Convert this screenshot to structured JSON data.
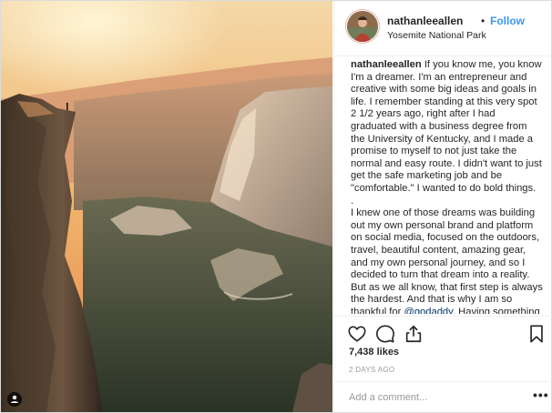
{
  "post": {
    "username": "nathanleeallen",
    "separator": "•",
    "follow_label": "Follow",
    "location": "Yosemite National Park",
    "caption": {
      "username": "nathanleeallen",
      "paragraph1": " If you know me, you know I'm a dreamer. I'm an entrepreneur and creative with some big ideas and goals in life. I remember standing at this very spot 2 1/2 years ago, right after I had graduated with a business degree from the University of Kentucky, and I made a promise to myself to not just take the normal and easy route. I didn't want to just get the safe marketing job and be \"comfortable.\" I wanted to do bold things.",
      "divider": ".",
      "paragraph2_before": "I knew one of those dreams was building out my own personal brand and platform on social media, focused on the outdoors, travel, beautiful content, amazing gear, and my own personal journey, and so I decided to turn that dream into a reality. But as we all know, that first step is always the hardest. And that is why I am so thankful for ",
      "mention": "@godaddy",
      "paragraph2_after": ". Having something simple"
    },
    "likes": "7,438 likes",
    "date": "2 DAYS AGO",
    "comment_placeholder": "Add a comment...",
    "more_label": "•••"
  },
  "icons": {
    "like": "heart-icon",
    "comment": "comment-icon",
    "share": "share-icon",
    "save": "bookmark-icon",
    "tag": "user-tag-icon"
  },
  "colors": {
    "link": "#3897f0",
    "text": "#262626",
    "muted": "#999999",
    "border": "#efefef"
  }
}
